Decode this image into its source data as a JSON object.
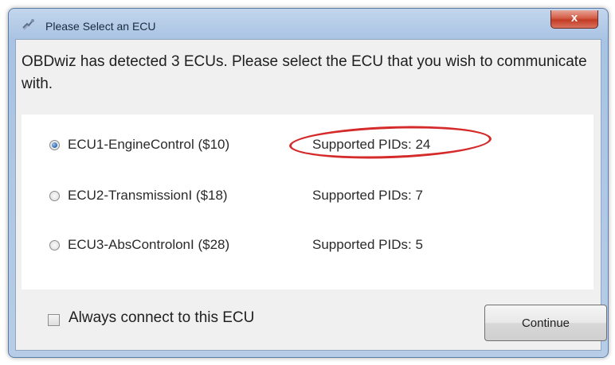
{
  "window": {
    "title": "Please Select an ECU",
    "close_label": "x"
  },
  "dialog": {
    "message": "OBDwiz has detected 3 ECUs. Please select the ECU that you wish to communicate with."
  },
  "ecus": [
    {
      "label": "ECU1-EngineControl ($10)",
      "pids": "Supported PIDs: 24",
      "selected": true,
      "highlighted": true
    },
    {
      "label": "ECU2-TransmissionI ($18)",
      "pids": "Supported PIDs: 7",
      "selected": false,
      "highlighted": false
    },
    {
      "label": "ECU3-AbsControlonI ($28)",
      "pids": "Supported PIDs: 5",
      "selected": false,
      "highlighted": false
    }
  ],
  "options": {
    "always_connect_label": "Always connect to this ECU",
    "always_connect_checked": false
  },
  "buttons": {
    "continue_label": "Continue"
  },
  "colors": {
    "highlight_ring": "#d42a2a",
    "radio_selected": "#2a67b4",
    "close_button": "#c23b24"
  }
}
